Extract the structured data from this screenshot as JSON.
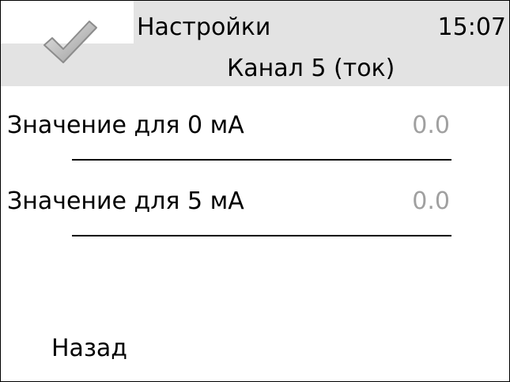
{
  "header": {
    "title": "Настройки",
    "time": "15:07",
    "subtitle": "Канал 5 (ток)",
    "confirm_icon": "checkmark-icon"
  },
  "settings": [
    {
      "label": "Значение для 0 мА",
      "value": "0.0"
    },
    {
      "label": "Значение для 5 мА",
      "value": "0.0"
    }
  ],
  "footer": {
    "back_label": "Назад"
  },
  "colors": {
    "header_background": "#e3e3e3",
    "value_text": "#a0a0a0",
    "check_gradient_light": "#e6e6e6",
    "check_gradient_dark": "#9a9a9a"
  }
}
